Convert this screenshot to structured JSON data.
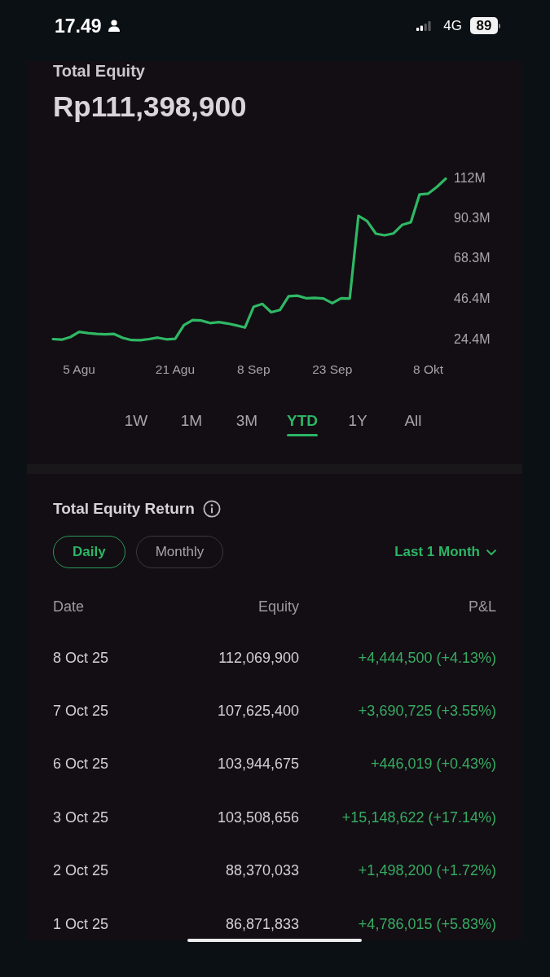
{
  "status_bar": {
    "time": "17.49",
    "network": "4G",
    "battery": "89"
  },
  "equity": {
    "title": "Total Equity",
    "value": "Rp111,398,900",
    "chart_data": {
      "type": "line",
      "categories": [
        null,
        null,
        null,
        "5 Agu",
        null,
        null,
        null,
        null,
        null,
        null,
        null,
        null,
        null,
        null,
        "21 Agu",
        null,
        null,
        null,
        null,
        null,
        null,
        null,
        null,
        "8 Sep",
        null,
        null,
        null,
        null,
        null,
        null,
        null,
        null,
        "23 Sep",
        null,
        null,
        null,
        null,
        null,
        null,
        null,
        null,
        null,
        null,
        "8 Okt",
        null,
        null
      ],
      "series": [
        {
          "color": "#2fb865",
          "values": [
            25.0,
            24.7,
            26.1,
            28.9,
            28.3,
            27.8,
            27.6,
            27.8,
            25.7,
            24.5,
            24.4,
            25.0,
            25.8,
            24.9,
            25.2,
            32.6,
            35.3,
            35.1,
            33.7,
            34.2,
            33.5,
            32.5,
            31.3,
            42.6,
            44.1,
            39.6,
            40.8,
            48.3,
            48.6,
            47.2,
            47.4,
            47.0,
            44.5,
            47.2,
            47.0,
            91.9,
            89.0,
            82.2,
            81.3,
            82.3,
            86.9,
            88.4,
            103.5,
            103.9,
            107.6,
            112.0
          ]
        }
      ],
      "ylim": [
        24.4,
        112
      ],
      "yticks": [
        {
          "value": 24.4,
          "label": "24.4M"
        },
        {
          "value": 46.4,
          "label": "46.4M"
        },
        {
          "value": 68.3,
          "label": "68.3M"
        },
        {
          "value": 90.3,
          "label": "90.3M"
        },
        {
          "value": 112,
          "label": "112M"
        }
      ]
    }
  },
  "period_tabs": [
    {
      "label": "1W",
      "selected": false
    },
    {
      "label": "1M",
      "selected": false
    },
    {
      "label": "3M",
      "selected": false
    },
    {
      "label": "YTD",
      "selected": true
    },
    {
      "label": "1Y",
      "selected": false
    },
    {
      "label": "All",
      "selected": false
    }
  ],
  "returns": {
    "title": "Total Equity Return",
    "view_toggle": [
      {
        "label": "Daily",
        "selected": true
      },
      {
        "label": "Monthly",
        "selected": false
      }
    ],
    "range_dropdown": "Last 1 Month",
    "table": {
      "columns": [
        "Date",
        "Equity",
        "P&L"
      ],
      "rows": [
        {
          "date": "8 Oct 25",
          "equity": "112,069,900",
          "pnl": "+4,444,500 (+4.13%)"
        },
        {
          "date": "7 Oct 25",
          "equity": "107,625,400",
          "pnl": "+3,690,725 (+3.55%)"
        },
        {
          "date": "6 Oct 25",
          "equity": "103,944,675",
          "pnl": "+446,019 (+0.43%)"
        },
        {
          "date": "3 Oct 25",
          "equity": "103,508,656",
          "pnl": "+15,148,622 (+17.14%)"
        },
        {
          "date": "2 Oct 25",
          "equity": "88,370,033",
          "pnl": "+1,498,200 (+1.72%)"
        },
        {
          "date": "1 Oct 25",
          "equity": "86,871,833",
          "pnl": "+4,786,015 (+5.83%)"
        }
      ]
    }
  }
}
